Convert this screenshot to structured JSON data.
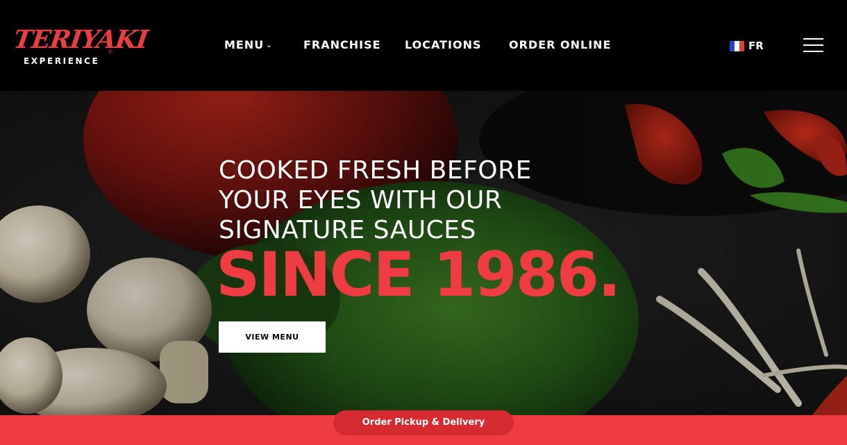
{
  "brand": {
    "logo_main": "TERIYAKI",
    "logo_sub": "EXPERIENCE",
    "logo_mark": "®",
    "accent_color": "#ef3b42"
  },
  "nav": {
    "items": [
      {
        "label": "MENU",
        "has_dropdown": true
      },
      {
        "label": "FRANCHISE"
      },
      {
        "label": "LOCATIONS"
      },
      {
        "label": "ORDER ONLINE"
      }
    ],
    "dropdown_icon": "chevron-down-icon"
  },
  "language": {
    "label": "FR",
    "flag_icon": "france-flag-icon",
    "flag_colors": [
      "#1f45c8",
      "#ffffff",
      "#e83a3a"
    ]
  },
  "menu_icon": "hamburger-menu-icon",
  "hero": {
    "headline_lines": [
      "COOKED FRESH BEFORE",
      "YOUR EYES WITH OUR",
      "SIGNATURE SAUCES"
    ],
    "highlight": "SINCE 1986.",
    "cta_label": "VIEW MENU"
  },
  "bottom_bar": {
    "cta_label": "Order Pickup & Delivery"
  }
}
